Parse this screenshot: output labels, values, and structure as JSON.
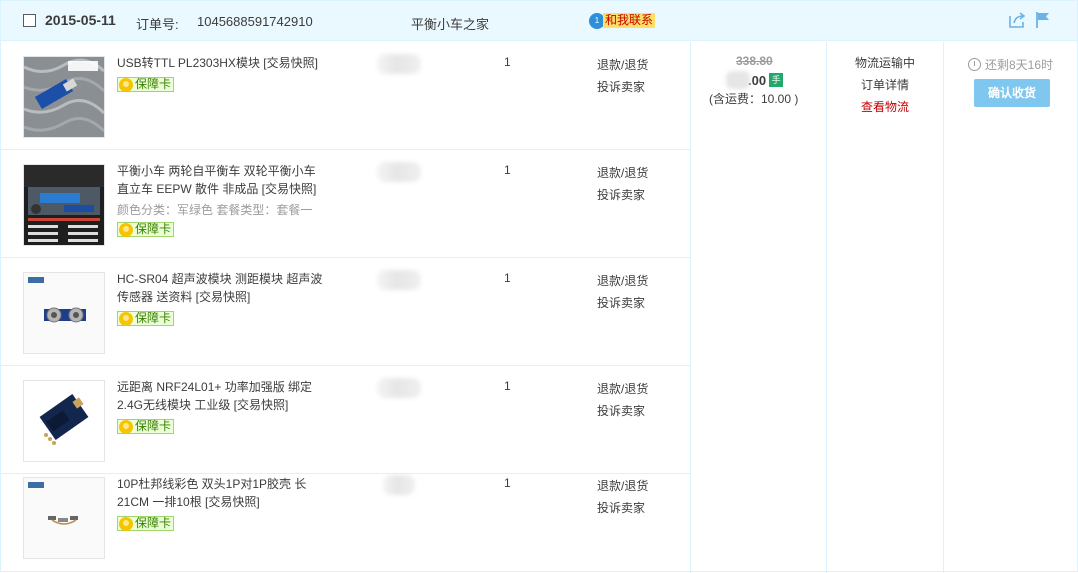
{
  "order": {
    "date": "2015-05-11",
    "order_no_label": "订单号:",
    "order_no": "1045688591742910",
    "shop": "平衡小车之家",
    "contact_label": "和我联系",
    "contact_badge": "1"
  },
  "items": [
    {
      "title": "USB转TTL PL2303HX模块 [交易快照]",
      "sku": "",
      "badge": "保障卡",
      "qty": "1",
      "refund": "退款/退货",
      "complain": "投诉卖家",
      "thumb": "usb-ttl-module"
    },
    {
      "title": "平衡小车 两轮自平衡车 双轮平衡小车 直立车 EEPW 散件 非成品 [交易快照]",
      "sku": "颜色分类：军绿色  套餐类型：套餐一",
      "badge": "保障卡",
      "qty": "1",
      "refund": "退款/退货",
      "complain": "投诉卖家",
      "thumb": "balance-car"
    },
    {
      "title": "HC-SR04 超声波模块 测距模块 超声波传感器 送资料 [交易快照]",
      "sku": "",
      "badge": "保障卡",
      "qty": "1",
      "refund": "退款/退货",
      "complain": "投诉卖家",
      "thumb": "ultrasonic-sensor"
    },
    {
      "title": "远距离 NRF24L01+ 功率加强版 绑定2.4G无线模块 工业级 [交易快照]",
      "sku": "",
      "badge": "保障卡",
      "qty": "1",
      "refund": "退款/退货",
      "complain": "投诉卖家",
      "thumb": "nrf24l01-module"
    },
    {
      "title": "10P杜邦线彩色 双头1P对1P胶壳 长21CM 一排10根 [交易快照]",
      "sku": "",
      "badge": "保障卡",
      "qty": "1",
      "refund": "退款/退货",
      "complain": "投诉卖家",
      "thumb": "dupont-wires"
    }
  ],
  "price": {
    "original": "338.80",
    "amount_suffix": ".00",
    "mobile_icon": "手",
    "shipping": "(含运费：10.00 )"
  },
  "status": {
    "state": "物流运输中",
    "detail": "订单详情",
    "logistics": "查看物流"
  },
  "action": {
    "remaining": "还剩8天16时",
    "confirm": "确认收货"
  },
  "colors": {
    "header_bg": "#eaf8ff",
    "border": "#daf3ff",
    "confirm_bg": "#7fc7ef",
    "logistics_link": "#c40000",
    "badge_green": "#3a7f00"
  }
}
